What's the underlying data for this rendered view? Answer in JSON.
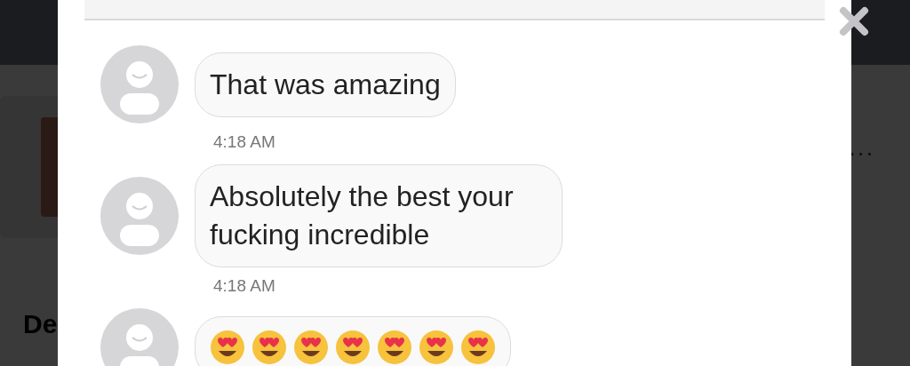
{
  "background": {
    "card_heading": "De",
    "more_text": "..."
  },
  "messages": [
    {
      "kind": "text",
      "text": "That was amazing",
      "time": "4:18 AM"
    },
    {
      "kind": "text",
      "text": "Absolutely the best your fucking incredible",
      "time": "4:18 AM"
    },
    {
      "kind": "emoji",
      "emojis": [
        {
          "kind": "heart_eyes"
        },
        {
          "kind": "heart_eyes"
        },
        {
          "kind": "heart_eyes"
        },
        {
          "kind": "heart_eyes"
        },
        {
          "kind": "heart_eyes"
        },
        {
          "kind": "heart_eyes"
        },
        {
          "kind": "heart_eyes"
        }
      ]
    }
  ]
}
